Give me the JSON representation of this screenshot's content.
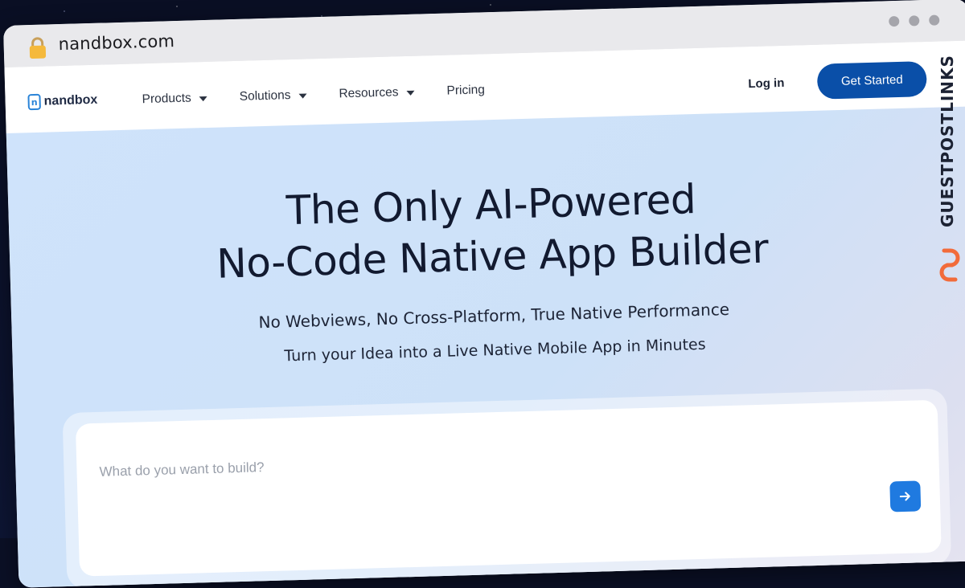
{
  "browser": {
    "url": "nandbox.com",
    "icons": {
      "lock": "lock-icon",
      "window_dots": "more-dots-icon"
    }
  },
  "nav": {
    "logo_text": "nandbox",
    "logo_letter": "n",
    "menu": [
      {
        "label": "Products",
        "has_dropdown": true
      },
      {
        "label": "Solutions",
        "has_dropdown": true
      },
      {
        "label": "Resources",
        "has_dropdown": true
      },
      {
        "label": "Pricing",
        "has_dropdown": false
      }
    ],
    "login_label": "Log in",
    "cta_label": "Get Started"
  },
  "hero": {
    "title_line1": "The Only AI-Powered",
    "title_line2": "No-Code Native App Builder",
    "subtitle": "No Webviews, No Cross-Platform, True Native Performance",
    "subtitle2": "Turn your Idea into a Live Native Mobile App in Minutes",
    "prompt_placeholder": "What do you want to build?",
    "prompt_value": ""
  },
  "watermark": {
    "text": "GUESTPOSTLINKS"
  },
  "colors": {
    "accent": "#0a4fa8",
    "send_button": "#1f7ae0",
    "hero_bg": "#cfe3fb",
    "logo": "#2a84d8",
    "watermark_icon": "#f26b3a"
  }
}
